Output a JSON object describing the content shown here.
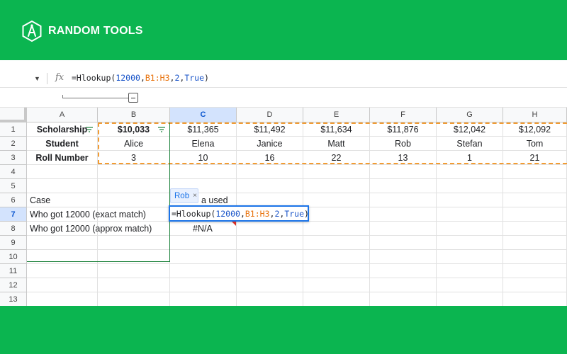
{
  "brand": {
    "name": "RANDOM TOOLS",
    "band_color": "#0bb550",
    "logo_icon": "compass-hexagon-icon"
  },
  "formula_bar": {
    "fx_label": "fx",
    "parts": [
      {
        "text": "=Hlookup(",
        "color": "default"
      },
      {
        "text": "12000",
        "color": "blue"
      },
      {
        "text": ",",
        "color": "default"
      },
      {
        "text": "B1:H3",
        "color": "orange"
      },
      {
        "text": ",",
        "color": "default"
      },
      {
        "text": "2",
        "color": "blue"
      },
      {
        "text": ",",
        "color": "default"
      },
      {
        "text": "True",
        "color": "blue"
      },
      {
        "text": ")",
        "color": "default"
      }
    ]
  },
  "columns": [
    "A",
    "B",
    "C",
    "D",
    "E",
    "F",
    "G",
    "H"
  ],
  "selected_column": "C",
  "selected_row": "7",
  "rows": [
    "1",
    "2",
    "3",
    "4",
    "5",
    "6",
    "7",
    "8",
    "9",
    "10",
    "11",
    "12",
    "13"
  ],
  "cells": {
    "A1": "Scholarship",
    "B1": "$10,033",
    "C1": "$11,365",
    "D1": "$11,492",
    "E1": "$11,634",
    "F1": "$11,876",
    "G1": "$12,042",
    "H1": "$12,092",
    "A2": "Student",
    "B2": "Alice",
    "C2": "Elena",
    "D2": "Janice",
    "E2": "Matt",
    "F2": "Rob",
    "G2": "Stefan",
    "H2": "Tom",
    "A3": "Roll Number",
    "B3": "3",
    "C3": "10",
    "D3": "16",
    "E3": "22",
    "F3": "13",
    "G3": "1",
    "H3": "21",
    "A6": "Case",
    "C6": "a used",
    "A7": "Who got 12000 (exact match)",
    "A8": "Who got 12000 (approx match)",
    "C8": "#N/A"
  },
  "preview_chip": {
    "label": "Rob",
    "close": "×"
  },
  "editor": {
    "parts": [
      {
        "text": "=Hlookup(",
        "color": "default"
      },
      {
        "text": "12000",
        "color": "blue"
      },
      {
        "text": ",",
        "color": "default"
      },
      {
        "text": "B1:H3",
        "color": "orange"
      },
      {
        "text": ",",
        "color": "default"
      },
      {
        "text": "2",
        "color": "blue"
      },
      {
        "text": ",",
        "color": "default"
      },
      {
        "text": "True",
        "color": "blue"
      },
      {
        "text": ")",
        "color": "default"
      }
    ]
  },
  "colors": {
    "accent_blue": "#1a73e8",
    "range_orange": "#f29c33",
    "error_red": "#d93025"
  }
}
